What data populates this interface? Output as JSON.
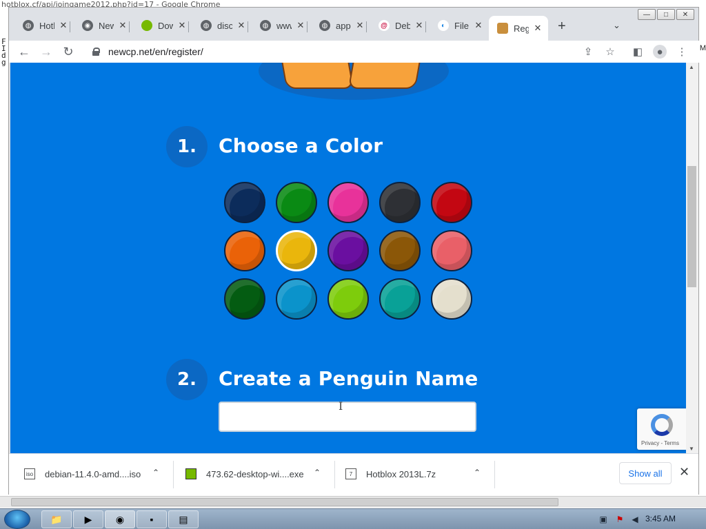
{
  "background": {
    "window_title": "hotblox.cf/api/joingame2012.php?id=17 - Google Chrome",
    "left_chars": [
      "F",
      "I",
      "d",
      "g"
    ],
    "right_chars": "M"
  },
  "window_controls": {
    "minimize": "—",
    "restore": "□",
    "close": "✕"
  },
  "tabs": [
    {
      "title": "Hotblox",
      "icon": "globe-icon",
      "close": "✕"
    },
    {
      "title": "New Tab",
      "icon": "chrome-icon",
      "close": "✕"
    },
    {
      "title": "Download",
      "icon": "nvidia-icon",
      "close": "✕"
    },
    {
      "title": "discord",
      "icon": "globe-icon",
      "close": "✕"
    },
    {
      "title": "www",
      "icon": "globe-icon",
      "close": "✕"
    },
    {
      "title": "app",
      "icon": "globe-icon",
      "close": "✕"
    },
    {
      "title": "Debian",
      "icon": "debian-icon",
      "close": "✕"
    },
    {
      "title": "File",
      "icon": "file-icon",
      "close": "✕"
    },
    {
      "title": "Register",
      "icon": "penguin-icon",
      "close": "✕"
    }
  ],
  "tab_extras": {
    "new_tab": "+",
    "tab_search": "⌄"
  },
  "toolbar": {
    "back": "←",
    "forward": "→",
    "reload": "↻",
    "url": "newcp.net/en/register/",
    "share": "⇪",
    "bookmark": "☆",
    "side_panel": "◧",
    "profile": "●",
    "menu": "⋮"
  },
  "page": {
    "step1": {
      "number": "1.",
      "title": "Choose a Color"
    },
    "colors": [
      [
        "#0c2c5b",
        "#0a8a14",
        "#e8329a",
        "#2e3035",
        "#c30712"
      ],
      [
        "#ea6208",
        "#eab60c",
        "#6a0fa0",
        "#8b5708",
        "#e96068"
      ],
      [
        "#045c12",
        "#0b93cb",
        "#7ecc0c",
        "#09a197",
        "#e4dfcd"
      ]
    ],
    "selected_color": "#eab60c",
    "step2": {
      "number": "2.",
      "title": "Create a Penguin Name"
    },
    "name_input": {
      "value": "",
      "placeholder": ""
    },
    "recaptcha": {
      "text": "Privacy - Terms"
    }
  },
  "downloads": {
    "items": [
      {
        "name": "debian-11.4.0-amd....iso",
        "icon": "iso-file-icon",
        "icon_text": "iso"
      },
      {
        "name": "473.62-desktop-wi....exe",
        "icon": "nvidia-file-icon",
        "icon_text": ""
      },
      {
        "name": "Hotblox 2013L.7z",
        "icon": "archive-file-icon",
        "icon_text": "7"
      }
    ],
    "caret": "⌃",
    "show_all": "Show all",
    "close": "✕"
  },
  "taskbar": {
    "apps": [
      "folder-icon",
      "media-player-icon",
      "chrome-icon",
      "cmd-icon",
      "notepad-icon"
    ],
    "clock": "3:45 AM"
  }
}
